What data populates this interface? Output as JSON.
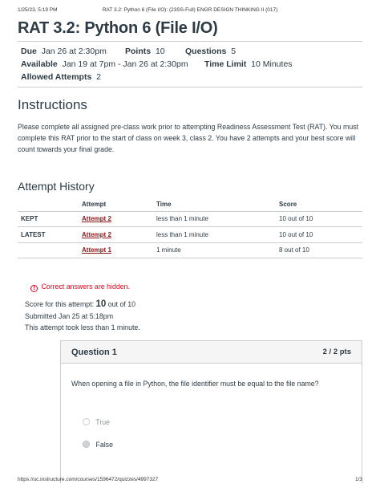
{
  "print_header": {
    "datetime": "1/25/23, 5:19 PM",
    "doc_title": "RAT 3.2: Python 6 (File I/O): (23SS-Full) ENGR DESIGN THINKING II (017)"
  },
  "print_footer": {
    "url": "https://uc.instructure.com/courses/1596472/quizzes/4997327",
    "page": "1/3"
  },
  "quiz": {
    "title": "RAT 3.2: Python 6 (File I/O)",
    "due_label": "Due",
    "due_value": "Jan 26 at 2:30pm",
    "points_label": "Points",
    "points_value": "10",
    "questions_label": "Questions",
    "questions_value": "5",
    "available_label": "Available",
    "available_value": "Jan 19 at 7pm - Jan 26 at 2:30pm",
    "time_limit_label": "Time Limit",
    "time_limit_value": "10 Minutes",
    "allowed_attempts_label": "Allowed Attempts",
    "allowed_attempts_value": "2"
  },
  "instructions": {
    "heading": "Instructions",
    "text": "Please complete all assigned pre-class work prior to attempting Readiness Assessment Test (RAT). You must complete this RAT prior to the start of class on week 3, class 2. You have 2 attempts and your best score will count towards your final grade."
  },
  "attempt_history": {
    "heading": "Attempt History",
    "columns": [
      "",
      "Attempt",
      "Time",
      "Score"
    ],
    "rows": [
      {
        "label": "KEPT",
        "attempt": "Attempt 2",
        "time": "less than 1 minute",
        "score": "10 out of 10"
      },
      {
        "label": "LATEST",
        "attempt": "Attempt 2",
        "time": "less than 1 minute",
        "score": "10 out of 10"
      },
      {
        "label": "",
        "attempt": "Attempt 1",
        "time": "1 minute",
        "score": "8 out of 10"
      }
    ]
  },
  "results": {
    "hidden_note": "Correct answers are hidden.",
    "warning_icon_glyph": "!",
    "score_prefix": "Score for this attempt:",
    "score_value": "10",
    "score_suffix": "out of 10",
    "submitted": "Submitted Jan 25 at 5:18pm",
    "duration": "This attempt took less than 1 minute."
  },
  "question_1": {
    "title": "Question 1",
    "points": "2 / 2 pts",
    "text": "When opening a file in Python, the file identifier must be equal to the file name?",
    "answers": [
      {
        "label": "True",
        "selected": false
      },
      {
        "label": "False",
        "selected": true
      }
    ]
  },
  "colors": {
    "text": "#2d3b45",
    "link": "#8b1a1a",
    "warning": "#e0061f",
    "border": "#c7cdd1",
    "header_bg": "#f5f5f5"
  }
}
